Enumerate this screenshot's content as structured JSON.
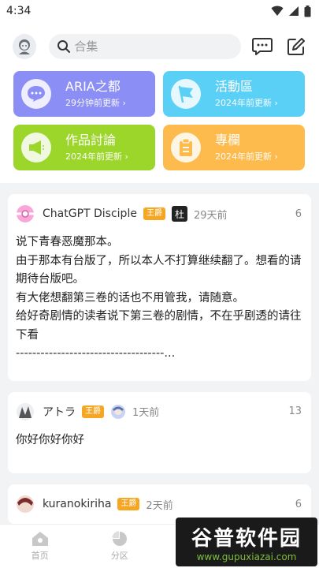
{
  "status_bar": {
    "time": "4:34"
  },
  "header": {
    "search_placeholder": "合集",
    "icons": {
      "avatar": "person-avatar-icon",
      "search": "search-icon",
      "chat": "chat-bubble-icon",
      "edit": "edit-icon"
    }
  },
  "tiles": [
    {
      "title": "ARIA之都",
      "sub": "29分钟前更新",
      "icon": "speech-bubble-icon",
      "color": "#8b8ef5"
    },
    {
      "title": "活動區",
      "sub": "2024年前更新",
      "icon": "flag-icon",
      "color": "#5bd0f7"
    },
    {
      "title": "作品討論",
      "sub": "2024年前更新",
      "icon": "megaphone-icon",
      "color": "#9cd62b"
    },
    {
      "title": "專欄",
      "sub": "2024年前更新",
      "icon": "clipboard-icon",
      "color": "#fdbb4d"
    }
  ],
  "tile_chevron": "›",
  "posts": [
    {
      "author": "ChatGPT Disciple",
      "badge": "王爵",
      "mini_avatar_text": "杜",
      "time": "29天前",
      "count": "6",
      "body": "说下青春恶魔那本。\n由于那本有台版了，所以本人不打算继续翻了。想看的请期待台版吧。\n有大佬想翻第三卷的话也不用管我，请随意。\n给好奇剧情的读者说下第三卷的剧情，不在乎剧透的请往下看\n------------------------------------..."
    },
    {
      "author": "アトラ",
      "badge": "王爵",
      "time": "1天前",
      "count": "13",
      "body": "你好你好你好"
    },
    {
      "author": "kuranokiriha",
      "badge": "王爵",
      "time": "2天前",
      "count": "6",
      "body": ""
    }
  ],
  "nav": [
    {
      "label": "首页",
      "icon": "home-icon"
    },
    {
      "label": "分区",
      "icon": "pie-chart-icon"
    },
    {
      "label": "",
      "icon": ""
    },
    {
      "label": "",
      "icon": ""
    }
  ],
  "watermark": {
    "main": "谷普软件园",
    "url": "www.gupuxiazai.com"
  }
}
